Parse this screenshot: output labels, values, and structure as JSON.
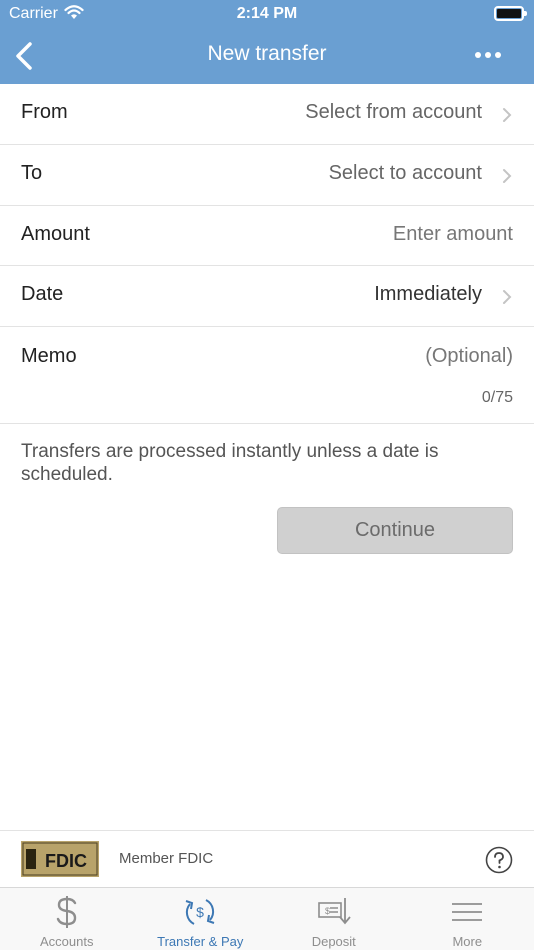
{
  "status_bar": {
    "carrier": "Carrier",
    "time": "2:14 PM"
  },
  "nav": {
    "title": "New transfer",
    "back_icon": "chevron-left-icon",
    "more_icon": "ellipsis-icon"
  },
  "form": {
    "from": {
      "label": "From",
      "value": "Select from account"
    },
    "to": {
      "label": "To",
      "value": "Select to account"
    },
    "amount": {
      "label": "Amount",
      "placeholder": "Enter amount"
    },
    "date": {
      "label": "Date",
      "value": "Immediately"
    },
    "memo": {
      "label": "Memo",
      "placeholder": "(Optional)",
      "counter": "0/75"
    }
  },
  "info_text": "Transfers are processed instantly unless a date is scheduled.",
  "continue_label": "Continue",
  "footer": {
    "logo_text": "FDIC",
    "member_text": "Member FDIC",
    "help_icon": "question-circle-icon"
  },
  "tabs": [
    {
      "label": "Accounts",
      "icon": "dollar-icon",
      "active": false
    },
    {
      "label": "Transfer & Pay",
      "icon": "transfer-cycle-icon",
      "active": true
    },
    {
      "label": "Deposit",
      "icon": "check-deposit-icon",
      "active": false
    },
    {
      "label": "More",
      "icon": "hamburger-menu-icon",
      "active": false
    }
  ],
  "colors": {
    "header": "#6a9fd2",
    "active_tab": "#3d78b4",
    "inactive_tab": "#8e8e8e",
    "button_disabled": "#d0d0d0"
  }
}
